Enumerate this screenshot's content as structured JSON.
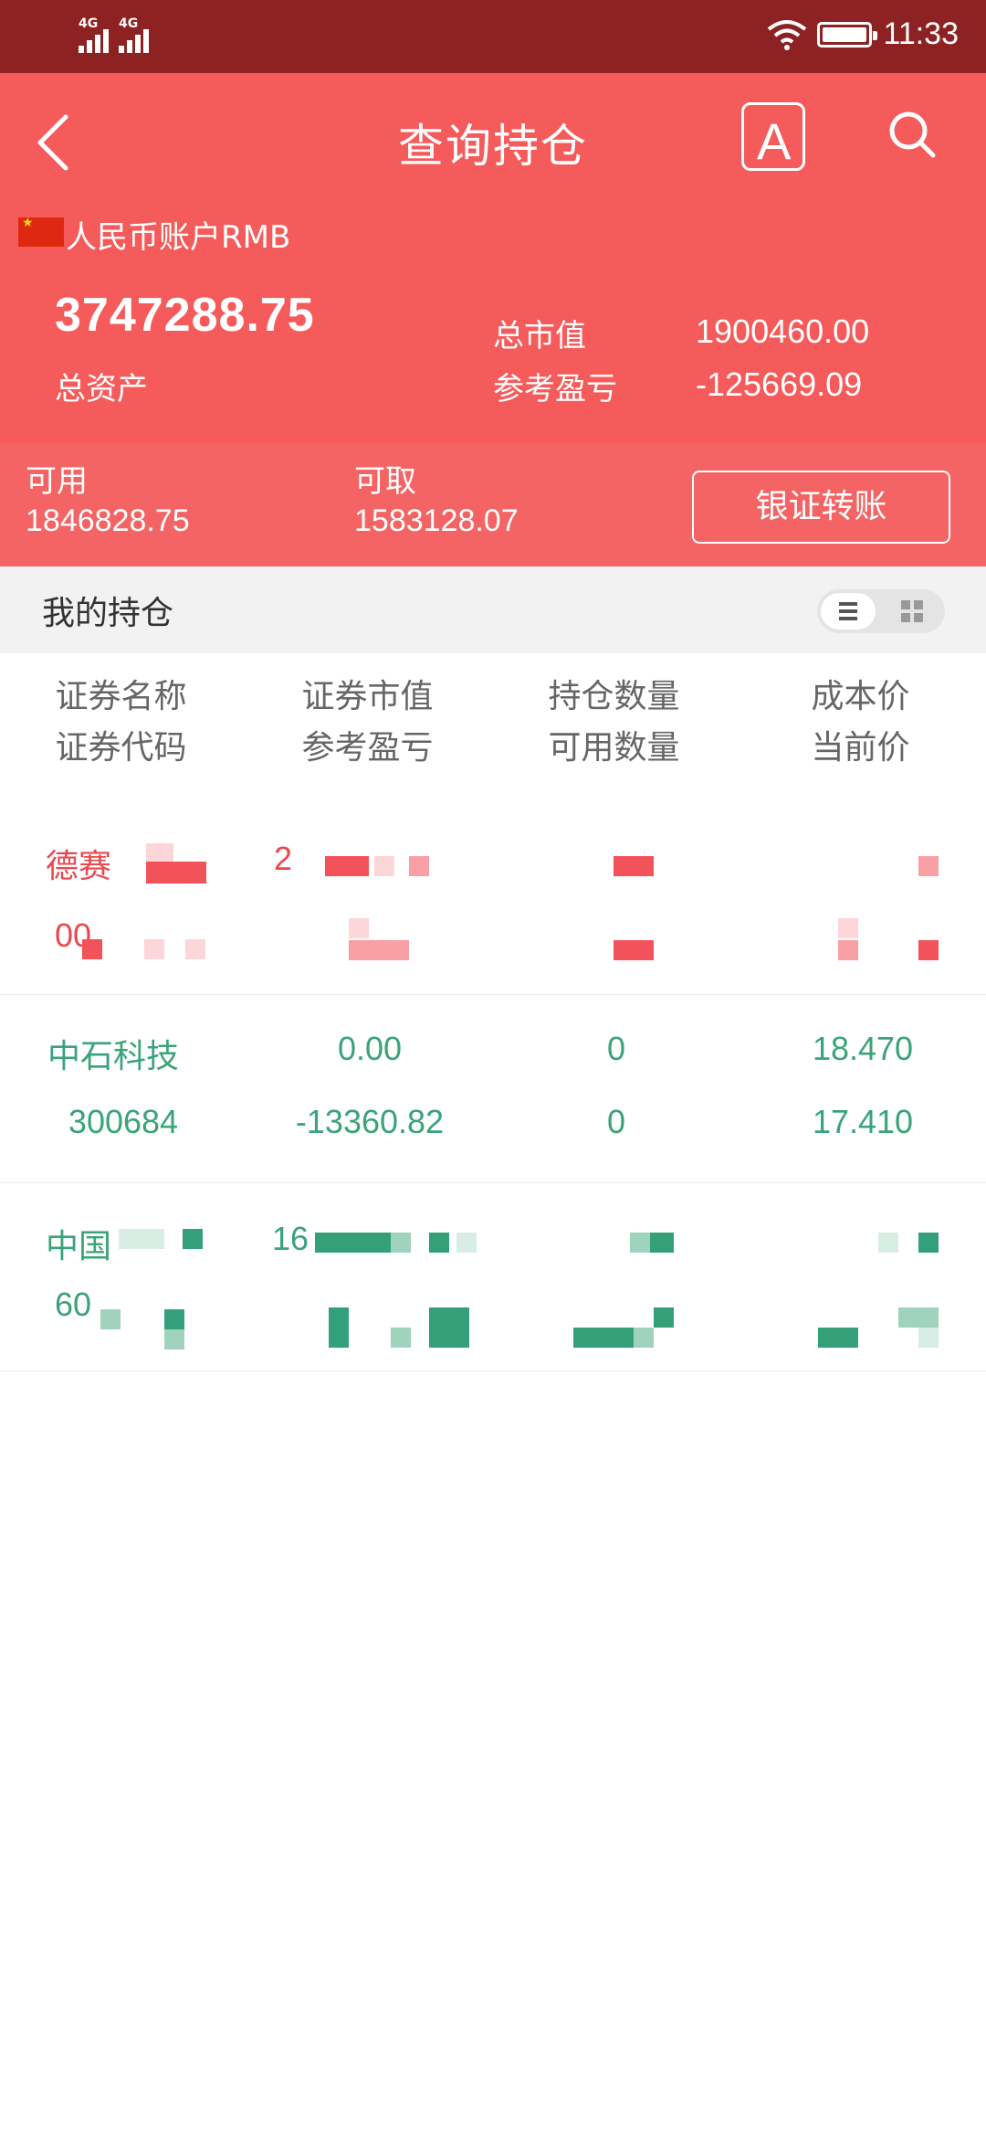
{
  "status_bar": {
    "signal1": "4G",
    "signal2": "4G",
    "time": "11:33"
  },
  "header": {
    "title": "查询持仓",
    "font_button_glyph": "A",
    "account_label": "人民币账户RMB",
    "total_assets_value": "3747288.75",
    "total_assets_label": "总资产",
    "market_value_label": "总市值",
    "market_value": "1900460.00",
    "pnl_label": "参考盈亏",
    "pnl_value": "-125669.09"
  },
  "funds": {
    "available_label": "可用",
    "available_value": "1846828.75",
    "withdrawable_label": "可取",
    "withdrawable_value": "1583128.07",
    "transfer_button": "银证转账"
  },
  "section": {
    "title": "我的持仓"
  },
  "columns": [
    {
      "line1": "证券名称",
      "line2": "证券代码"
    },
    {
      "line1": "证券市值",
      "line2": "参考盈亏"
    },
    {
      "line1": "持仓数量",
      "line2": "可用数量"
    },
    {
      "line1": "成本价",
      "line2": "当前价"
    }
  ],
  "positions": [
    {
      "name": "德赛",
      "code": "00",
      "market_value": "2",
      "pnl": "",
      "quantity": "",
      "available": "",
      "cost": "",
      "price": ""
    },
    {
      "name": "中石科技",
      "code": "300684",
      "market_value": "0.00",
      "pnl": "-13360.82",
      "quantity": "0",
      "available": "0",
      "cost": "18.470",
      "price": "17.410"
    },
    {
      "name": "中国",
      "code": "60",
      "market_value": "16",
      "pnl": "",
      "quantity": "",
      "available": "",
      "cost": "",
      "price": ""
    }
  ],
  "colors": {
    "status_bar": "#8e2222",
    "header": "#f55b5b",
    "funds_bar": "#f46464",
    "loss_green": "#3aa37a",
    "gain_red": "#e8494f"
  },
  "icons": {
    "back": "chevron-left-icon",
    "font": "font-size-icon",
    "search": "search-icon",
    "list_view": "list-view-icon",
    "grid_view": "grid-view-icon",
    "wifi": "wifi-icon",
    "battery": "battery-icon",
    "flag": "china-flag-icon"
  }
}
